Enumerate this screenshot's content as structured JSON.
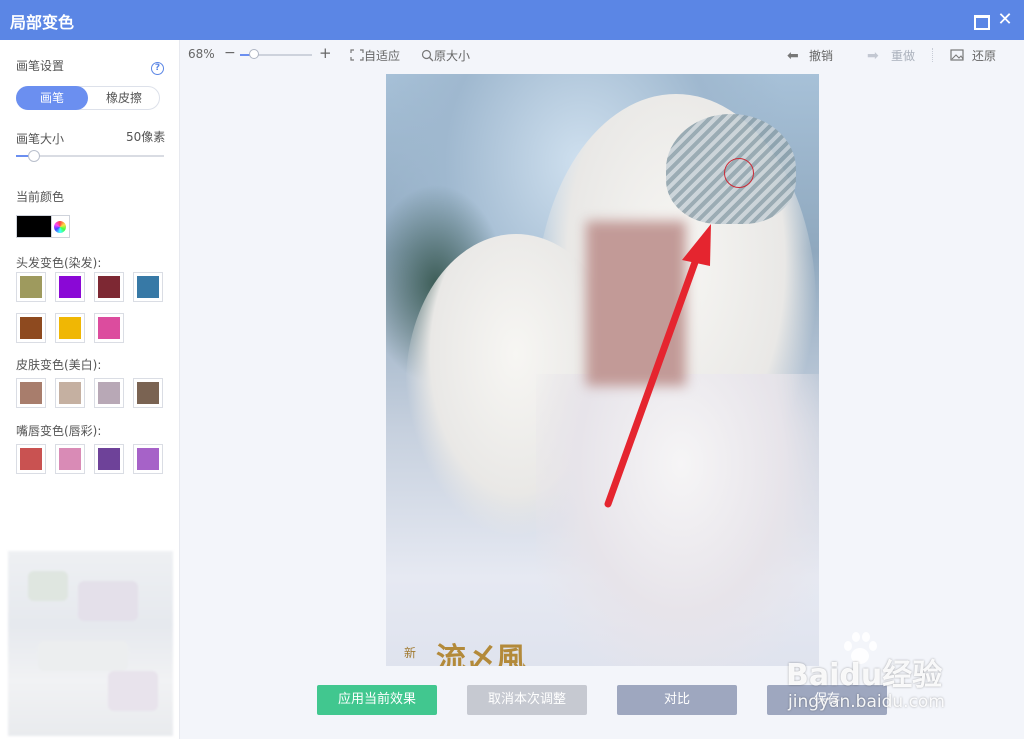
{
  "window": {
    "title": "局部变色"
  },
  "sidebar": {
    "brush_settings_label": "画笔设置",
    "mode_tabs": [
      "画笔",
      "橡皮擦"
    ],
    "brush_size_label": "画笔大小",
    "brush_size_value": "50像素",
    "brush_size_level": 0.12,
    "current_color_label": "当前颜色",
    "current_color": "#000000",
    "hair_label": "头发变色(染发):",
    "hair_colors": [
      "#9e9a5e",
      "#8a08d6",
      "#7d2833",
      "#3779a6",
      "#8e4a1f",
      "#f0b704",
      "#dc4c9e"
    ],
    "skin_label": "皮肤变色(美白):",
    "skin_colors": [
      "#a87d6c",
      "#c5b0a1",
      "#b8a8b6",
      "#7a6352"
    ],
    "lip_label": "嘴唇变色(唇彩):",
    "lip_colors": [
      "#c95251",
      "#d98bb6",
      "#6e4299",
      "#a662c8"
    ]
  },
  "toolbar": {
    "zoom": "68%",
    "zoom_minus": "−",
    "zoom_plus": "+",
    "fit_label": "自适应",
    "original_label": "原大小",
    "undo_label": "撤销",
    "redo_label": "重做",
    "restore_label": "还原"
  },
  "photo": {
    "caption_small": "新",
    "caption_large": "流〆風"
  },
  "actions": {
    "apply": "应用当前效果",
    "cancel": "取消本次调整",
    "compare": "对比",
    "save": "保存"
  },
  "watermark": {
    "brand": "Baidu经验",
    "url": "jingyan.baidu.com"
  },
  "colors": {
    "accent": "#5b86e5",
    "apply_button": "#41c78f",
    "arrow": "#e5252f"
  }
}
